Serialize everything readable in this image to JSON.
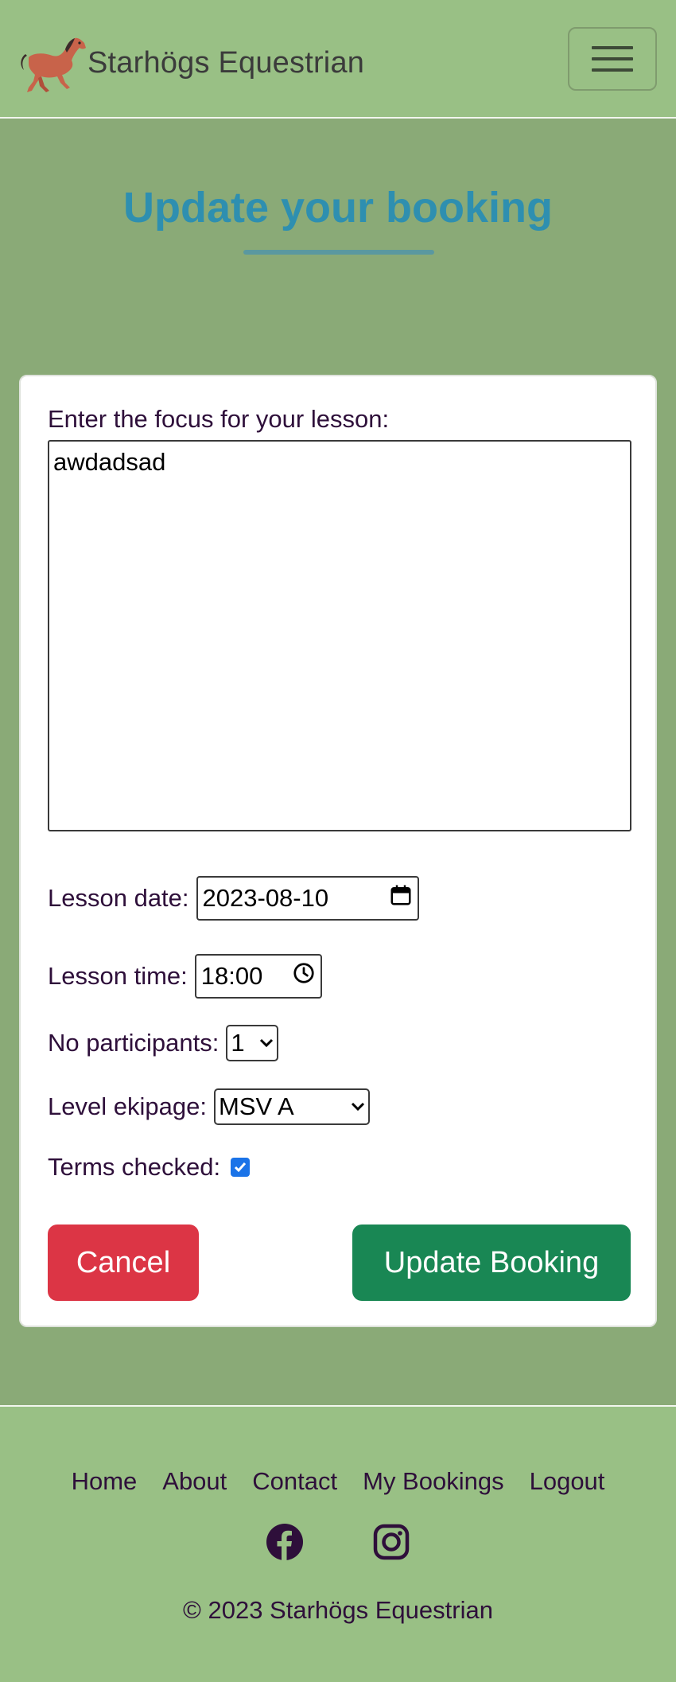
{
  "header": {
    "brand": "Starhögs Equestrian",
    "logo_icon": "horse-icon",
    "menu_icon": "hamburger-menu-icon"
  },
  "main": {
    "title": "Update your booking"
  },
  "form": {
    "focus_label": "Enter the focus for your lesson:",
    "focus_value": "awdadsad",
    "date_label": "Lesson date:",
    "date_value": "2023-08-10",
    "time_label": "Lesson time:",
    "time_value": "18:00",
    "participants_label": "No participants:",
    "participants_value": "1",
    "level_label": "Level ekipage:",
    "level_value": "MSV A",
    "terms_label": "Terms checked:",
    "terms_checked": true,
    "cancel_label": "Cancel",
    "update_label": "Update Booking"
  },
  "footer": {
    "links": [
      "Home",
      "About",
      "Contact",
      "My Bookings",
      "Logout"
    ],
    "social_icons": [
      "facebook-icon",
      "instagram-icon"
    ],
    "copyright": "© 2023 Starhögs Equestrian"
  },
  "colors": {
    "nav_bg": "#99c085",
    "page_bg": "#8aaa77",
    "title": "#2e8fb0",
    "cancel": "#dc3545",
    "update": "#198754",
    "text": "#2e0f3a"
  }
}
